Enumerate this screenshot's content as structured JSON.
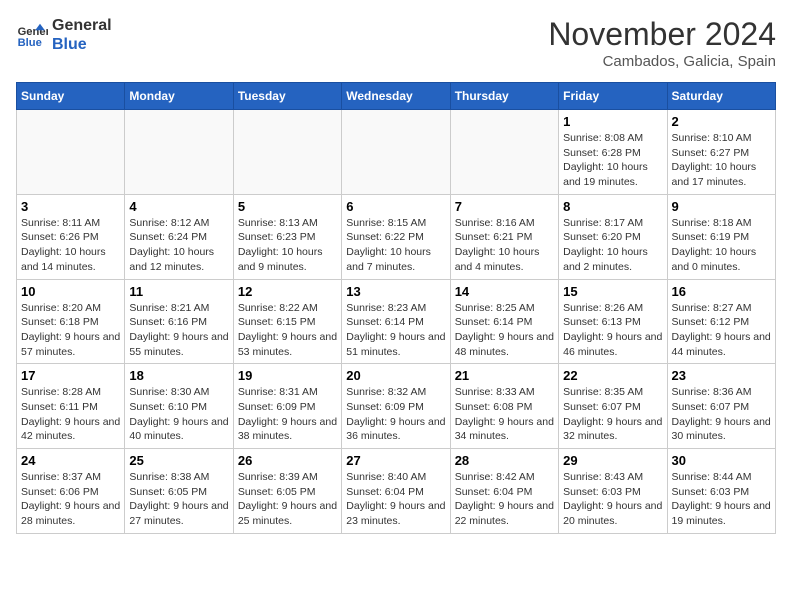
{
  "header": {
    "logo_line1": "General",
    "logo_line2": "Blue",
    "month": "November 2024",
    "location": "Cambados, Galicia, Spain"
  },
  "weekdays": [
    "Sunday",
    "Monday",
    "Tuesday",
    "Wednesday",
    "Thursday",
    "Friday",
    "Saturday"
  ],
  "weeks": [
    [
      {
        "day": "",
        "info": ""
      },
      {
        "day": "",
        "info": ""
      },
      {
        "day": "",
        "info": ""
      },
      {
        "day": "",
        "info": ""
      },
      {
        "day": "",
        "info": ""
      },
      {
        "day": "1",
        "info": "Sunrise: 8:08 AM\nSunset: 6:28 PM\nDaylight: 10 hours and 19 minutes."
      },
      {
        "day": "2",
        "info": "Sunrise: 8:10 AM\nSunset: 6:27 PM\nDaylight: 10 hours and 17 minutes."
      }
    ],
    [
      {
        "day": "3",
        "info": "Sunrise: 8:11 AM\nSunset: 6:26 PM\nDaylight: 10 hours and 14 minutes."
      },
      {
        "day": "4",
        "info": "Sunrise: 8:12 AM\nSunset: 6:24 PM\nDaylight: 10 hours and 12 minutes."
      },
      {
        "day": "5",
        "info": "Sunrise: 8:13 AM\nSunset: 6:23 PM\nDaylight: 10 hours and 9 minutes."
      },
      {
        "day": "6",
        "info": "Sunrise: 8:15 AM\nSunset: 6:22 PM\nDaylight: 10 hours and 7 minutes."
      },
      {
        "day": "7",
        "info": "Sunrise: 8:16 AM\nSunset: 6:21 PM\nDaylight: 10 hours and 4 minutes."
      },
      {
        "day": "8",
        "info": "Sunrise: 8:17 AM\nSunset: 6:20 PM\nDaylight: 10 hours and 2 minutes."
      },
      {
        "day": "9",
        "info": "Sunrise: 8:18 AM\nSunset: 6:19 PM\nDaylight: 10 hours and 0 minutes."
      }
    ],
    [
      {
        "day": "10",
        "info": "Sunrise: 8:20 AM\nSunset: 6:18 PM\nDaylight: 9 hours and 57 minutes."
      },
      {
        "day": "11",
        "info": "Sunrise: 8:21 AM\nSunset: 6:16 PM\nDaylight: 9 hours and 55 minutes."
      },
      {
        "day": "12",
        "info": "Sunrise: 8:22 AM\nSunset: 6:15 PM\nDaylight: 9 hours and 53 minutes."
      },
      {
        "day": "13",
        "info": "Sunrise: 8:23 AM\nSunset: 6:14 PM\nDaylight: 9 hours and 51 minutes."
      },
      {
        "day": "14",
        "info": "Sunrise: 8:25 AM\nSunset: 6:14 PM\nDaylight: 9 hours and 48 minutes."
      },
      {
        "day": "15",
        "info": "Sunrise: 8:26 AM\nSunset: 6:13 PM\nDaylight: 9 hours and 46 minutes."
      },
      {
        "day": "16",
        "info": "Sunrise: 8:27 AM\nSunset: 6:12 PM\nDaylight: 9 hours and 44 minutes."
      }
    ],
    [
      {
        "day": "17",
        "info": "Sunrise: 8:28 AM\nSunset: 6:11 PM\nDaylight: 9 hours and 42 minutes."
      },
      {
        "day": "18",
        "info": "Sunrise: 8:30 AM\nSunset: 6:10 PM\nDaylight: 9 hours and 40 minutes."
      },
      {
        "day": "19",
        "info": "Sunrise: 8:31 AM\nSunset: 6:09 PM\nDaylight: 9 hours and 38 minutes."
      },
      {
        "day": "20",
        "info": "Sunrise: 8:32 AM\nSunset: 6:09 PM\nDaylight: 9 hours and 36 minutes."
      },
      {
        "day": "21",
        "info": "Sunrise: 8:33 AM\nSunset: 6:08 PM\nDaylight: 9 hours and 34 minutes."
      },
      {
        "day": "22",
        "info": "Sunrise: 8:35 AM\nSunset: 6:07 PM\nDaylight: 9 hours and 32 minutes."
      },
      {
        "day": "23",
        "info": "Sunrise: 8:36 AM\nSunset: 6:07 PM\nDaylight: 9 hours and 30 minutes."
      }
    ],
    [
      {
        "day": "24",
        "info": "Sunrise: 8:37 AM\nSunset: 6:06 PM\nDaylight: 9 hours and 28 minutes."
      },
      {
        "day": "25",
        "info": "Sunrise: 8:38 AM\nSunset: 6:05 PM\nDaylight: 9 hours and 27 minutes."
      },
      {
        "day": "26",
        "info": "Sunrise: 8:39 AM\nSunset: 6:05 PM\nDaylight: 9 hours and 25 minutes."
      },
      {
        "day": "27",
        "info": "Sunrise: 8:40 AM\nSunset: 6:04 PM\nDaylight: 9 hours and 23 minutes."
      },
      {
        "day": "28",
        "info": "Sunrise: 8:42 AM\nSunset: 6:04 PM\nDaylight: 9 hours and 22 minutes."
      },
      {
        "day": "29",
        "info": "Sunrise: 8:43 AM\nSunset: 6:03 PM\nDaylight: 9 hours and 20 minutes."
      },
      {
        "day": "30",
        "info": "Sunrise: 8:44 AM\nSunset: 6:03 PM\nDaylight: 9 hours and 19 minutes."
      }
    ]
  ]
}
